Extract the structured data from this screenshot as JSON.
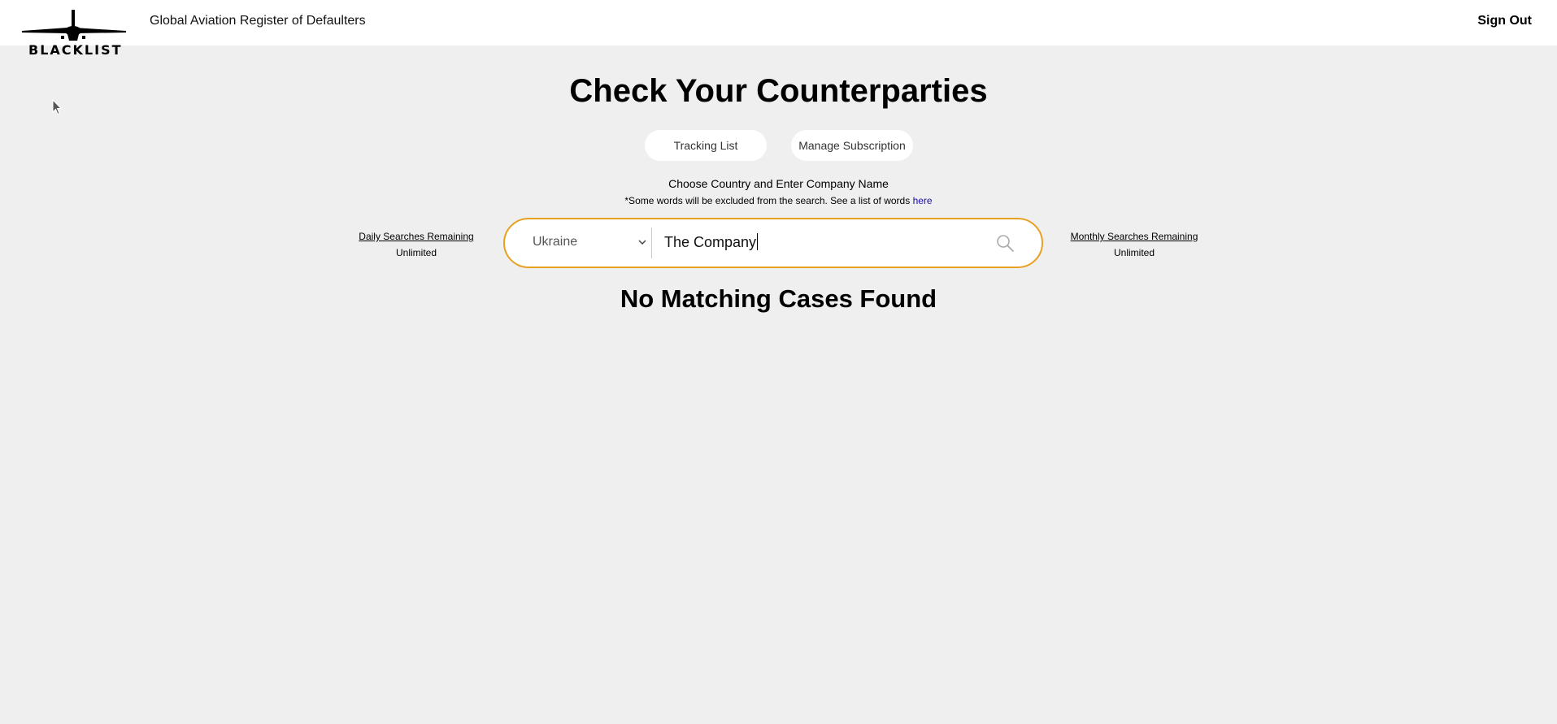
{
  "header": {
    "logo_text": "BLACKLIST",
    "site_title": "Global Aviation Register of Defaulters",
    "sign_out_label": "Sign Out"
  },
  "main": {
    "title": "Check Your Counterparties",
    "buttons": {
      "tracking_list": "Tracking List",
      "manage_subscription": "Manage Subscription"
    },
    "instruction": "Choose Country and Enter Company Name",
    "note": {
      "text": "*Some words will be excluded from the search. See a list of words",
      "link": "here"
    },
    "daily": {
      "label": "Daily Searches Remaining",
      "value": "Unlimited"
    },
    "monthly": {
      "label": "Monthly Searches Remaining",
      "value": "Unlimited"
    },
    "search": {
      "country": "Ukraine",
      "company": "The Company"
    },
    "result": "No Matching Cases Found"
  },
  "colors": {
    "background": "#efefef",
    "header": "#ffffff",
    "accent": "#e8a020",
    "link": "#1a0dab"
  },
  "icons": {
    "logo": "airplane-icon",
    "search": "search-icon",
    "dropdown": "chevron-down-icon"
  }
}
